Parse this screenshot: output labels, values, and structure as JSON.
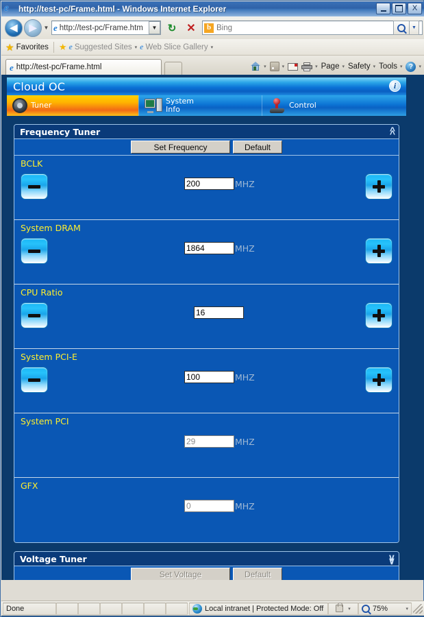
{
  "browser": {
    "window_title": "http://test-pc/Frame.html - Windows Internet Explorer",
    "minimize_label": "Minimize",
    "maximize_label": "Maximize",
    "close_label": "X",
    "back_label": "◀",
    "forward_label": "▶",
    "history_caret": "▼",
    "address_value": "http://test-pc/Frame.htm",
    "address_dropdown": "▼",
    "refresh_label": "↻",
    "stop_label": "✕",
    "search_value": "Bing",
    "search_dropdown": "▼",
    "favorites_label": "Favorites",
    "suggested_sites_label": "Suggested Sites",
    "web_slice_label": "Web Slice Gallery",
    "caret": "▾",
    "tab_label": "http://test-pc/Frame.html",
    "commands": {
      "home": "",
      "feeds": "",
      "read_mail": "",
      "print": "",
      "page": "Page",
      "safety": "Safety",
      "tools": "Tools",
      "help": "?"
    },
    "status": {
      "done": "Done",
      "zone": "Local intranet | Protected Mode: Off",
      "zoom": "75%",
      "zoom_caret": "▾",
      "protect_caret": "▾"
    }
  },
  "app": {
    "title": "Cloud OC",
    "info_badge": "i",
    "tabs": [
      {
        "label_line1": "Tuner",
        "label_line2": "",
        "icon": "steering-wheel-icon",
        "active": true
      },
      {
        "label_line1": "System",
        "label_line2": "Info",
        "icon": "computer-icon",
        "active": false
      },
      {
        "label_line1": "Control",
        "label_line2": "",
        "icon": "joystick-icon",
        "active": false
      }
    ],
    "frequency_panel": {
      "title": "Frequency Tuner",
      "collapse_icon": "chevron-up-icon",
      "set_button": "Set Frequency",
      "default_button": "Default",
      "rows": [
        {
          "label": "BCLK",
          "value": "200",
          "unit": "MHZ",
          "has_steppers": true,
          "disabled": false,
          "value_offset": 248
        },
        {
          "label": "System DRAM",
          "value": "1864",
          "unit": "MHZ",
          "has_steppers": true,
          "disabled": false,
          "value_offset": 248
        },
        {
          "label": "CPU Ratio",
          "value": "16",
          "unit": "",
          "has_steppers": true,
          "disabled": false,
          "value_offset": 262
        },
        {
          "label": "System PCI-E",
          "value": "100",
          "unit": "MHZ",
          "has_steppers": true,
          "disabled": false,
          "value_offset": 248
        },
        {
          "label": "System PCI",
          "value": "29",
          "unit": "MHZ",
          "has_steppers": false,
          "disabled": true,
          "value_offset": 248
        },
        {
          "label": "GFX",
          "value": "0",
          "unit": "MHZ",
          "has_steppers": false,
          "disabled": true,
          "value_offset": 248
        }
      ],
      "minus_sign": "−",
      "plus_sign": "+"
    },
    "voltage_panel": {
      "title": "Voltage Tuner",
      "expand_icon": "chevron-down-icon",
      "set_button": "Set Voltage",
      "default_button": "Default"
    },
    "colors": {
      "page_background": "#0b3a6b",
      "row_background": "#0a57b4",
      "panel_border": "#9fc4e8",
      "label_yellow": "#ffef2e",
      "active_tab_orange": "#f26a15",
      "unit_grey_blue": "#9fb8d4"
    }
  }
}
